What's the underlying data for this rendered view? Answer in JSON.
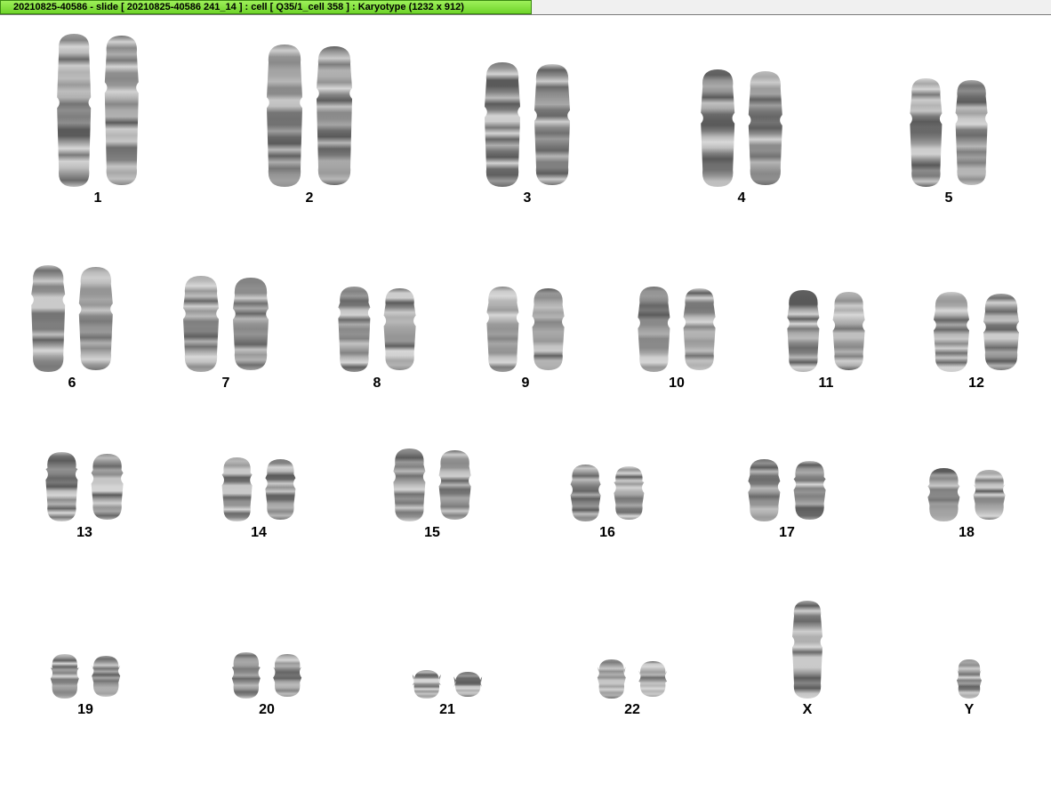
{
  "window": {
    "title": "20210825-40586 - slide [ 20210825-40586 241_14 ] : cell [ Q35/1_cell 358 ] : Karyotype  (1232 x 912)"
  },
  "karyotype": {
    "chromosomes": [
      {
        "label": "1"
      },
      {
        "label": "2"
      },
      {
        "label": "3"
      },
      {
        "label": "4"
      },
      {
        "label": "5"
      },
      {
        "label": "6"
      },
      {
        "label": "7"
      },
      {
        "label": "8"
      },
      {
        "label": "9"
      },
      {
        "label": "10"
      },
      {
        "label": "11"
      },
      {
        "label": "12"
      },
      {
        "label": "13"
      },
      {
        "label": "14"
      },
      {
        "label": "15"
      },
      {
        "label": "16"
      },
      {
        "label": "17"
      },
      {
        "label": "18"
      },
      {
        "label": "19"
      },
      {
        "label": "20"
      },
      {
        "label": "21"
      },
      {
        "label": "22"
      },
      {
        "label": "X"
      },
      {
        "label": "Y"
      }
    ]
  }
}
